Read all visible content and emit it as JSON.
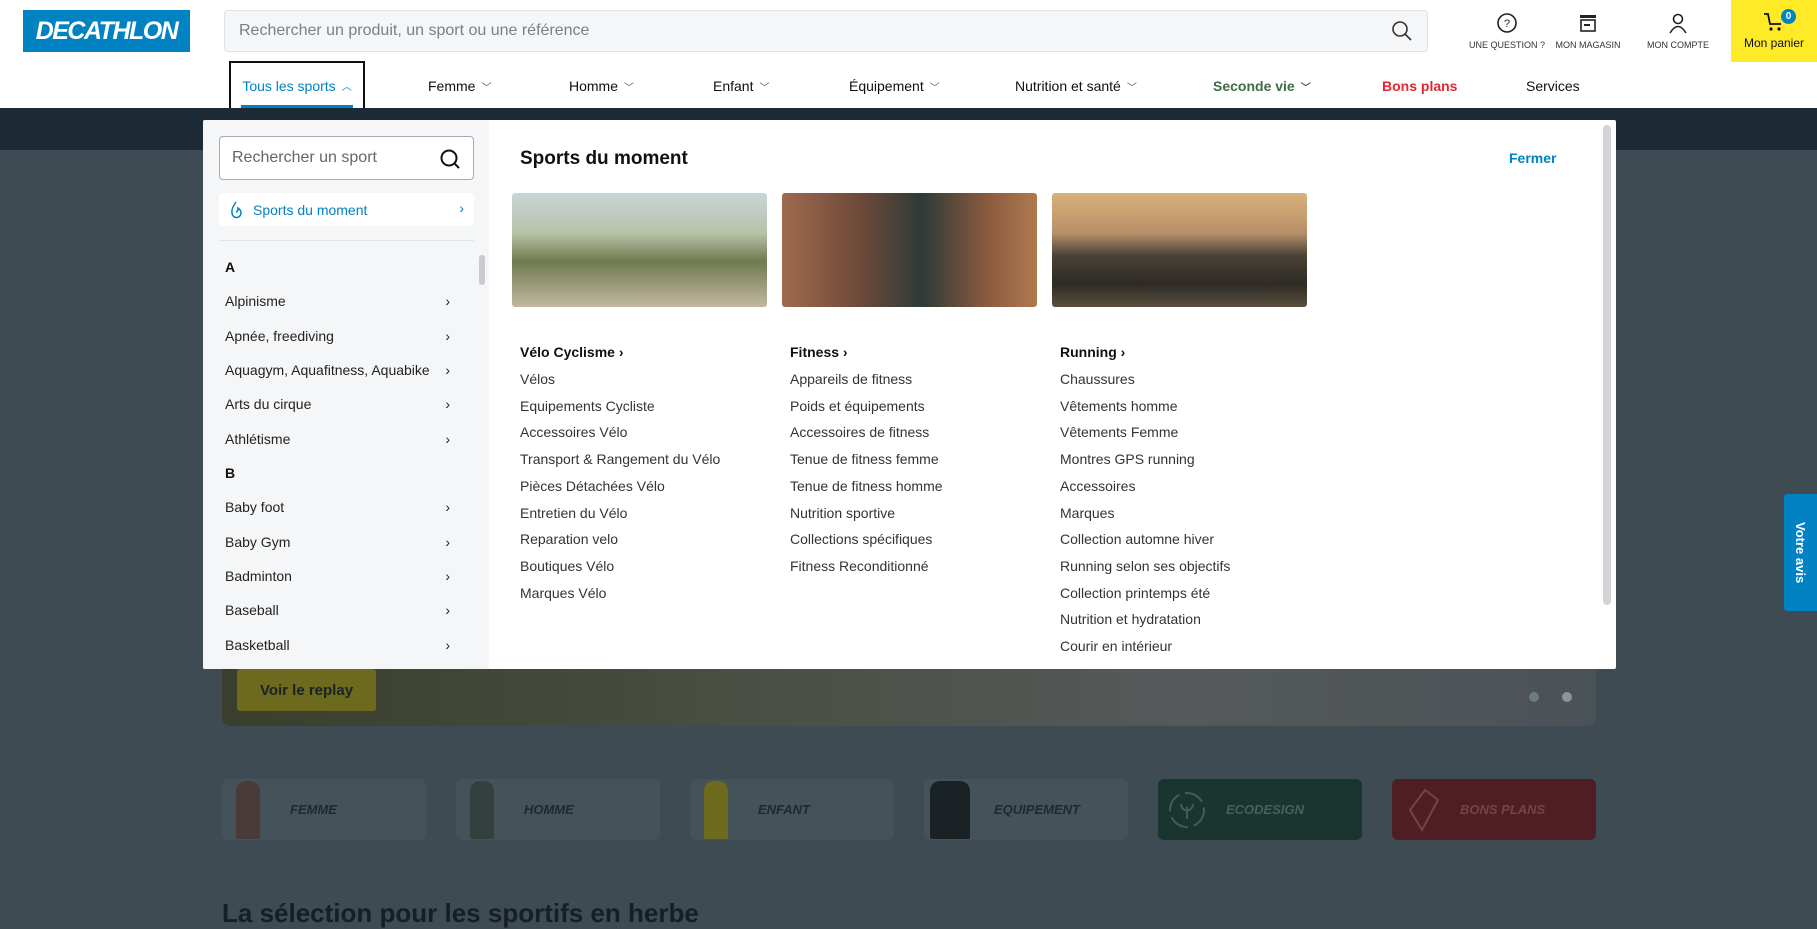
{
  "header": {
    "logo": "DECATHLON",
    "search_placeholder": "Rechercher un produit, un sport ou une référence",
    "question": "UNE QUESTION ?",
    "store": "MON MAGASIN",
    "account": "MON COMPTE",
    "cart": "Mon panier",
    "cart_count": "0"
  },
  "nav": [
    {
      "label": "Tous les sports",
      "color": "#0082c3"
    },
    {
      "label": "Femme"
    },
    {
      "label": "Homme"
    },
    {
      "label": "Enfant"
    },
    {
      "label": "Équipement"
    },
    {
      "label": "Nutrition et santé"
    },
    {
      "label": "Seconde vie",
      "color": "#3c6e3f"
    },
    {
      "label": "Bons plans",
      "color": "#e3262f"
    },
    {
      "label": "Services"
    }
  ],
  "menu": {
    "search_placeholder": "Rechercher un sport",
    "moment": "Sports du moment",
    "title": "Sports du moment",
    "close": "Fermer",
    "letters": [
      "A",
      "B"
    ],
    "sports_a": [
      "Alpinisme",
      "Apnée, freediving",
      "Aquagym, Aquafitness, Aquabike",
      "Arts du cirque",
      "Athlétisme"
    ],
    "sports_b": [
      "Baby foot",
      "Baby Gym",
      "Badminton",
      "Baseball",
      "Basketball"
    ],
    "columns": [
      {
        "title": "Vélo Cyclisme",
        "links": [
          "Vélos",
          "Equipements Cycliste",
          "Accessoires Vélo",
          "Transport & Rangement du Vélo",
          "Pièces Détachées Vélo",
          "Entretien du Vélo",
          "Reparation velo",
          "Boutiques Vélo",
          "Marques Vélo"
        ]
      },
      {
        "title": "Fitness",
        "links": [
          "Appareils de fitness",
          "Poids et équipements",
          "Accessoires de fitness",
          "Tenue de fitness femme",
          "Tenue de fitness homme",
          "Nutrition sportive",
          "Collections spécifiques",
          "Fitness Reconditionné"
        ]
      },
      {
        "title": "Running",
        "links": [
          "Chaussures",
          "Vêtements homme",
          "Vêtements Femme",
          "Montres GPS running",
          "Accessoires",
          "Marques",
          "Collection automne hiver",
          "Running selon ses objectifs",
          "Collection printemps été",
          "Nutrition et hydratation",
          "Courir en intérieur"
        ]
      }
    ]
  },
  "feedback": "Votre avis",
  "page": {
    "replay": "Voir le replay",
    "categories": [
      "FEMME",
      "HOMME",
      "ENFANT",
      "EQUIPEMENT",
      "ECODESIGN",
      "BONS PLANS"
    ],
    "heading": "La sélection pour les sportifs en herbe"
  },
  "colors": {
    "brand": "#0082c3",
    "cart": "#ffea28"
  }
}
